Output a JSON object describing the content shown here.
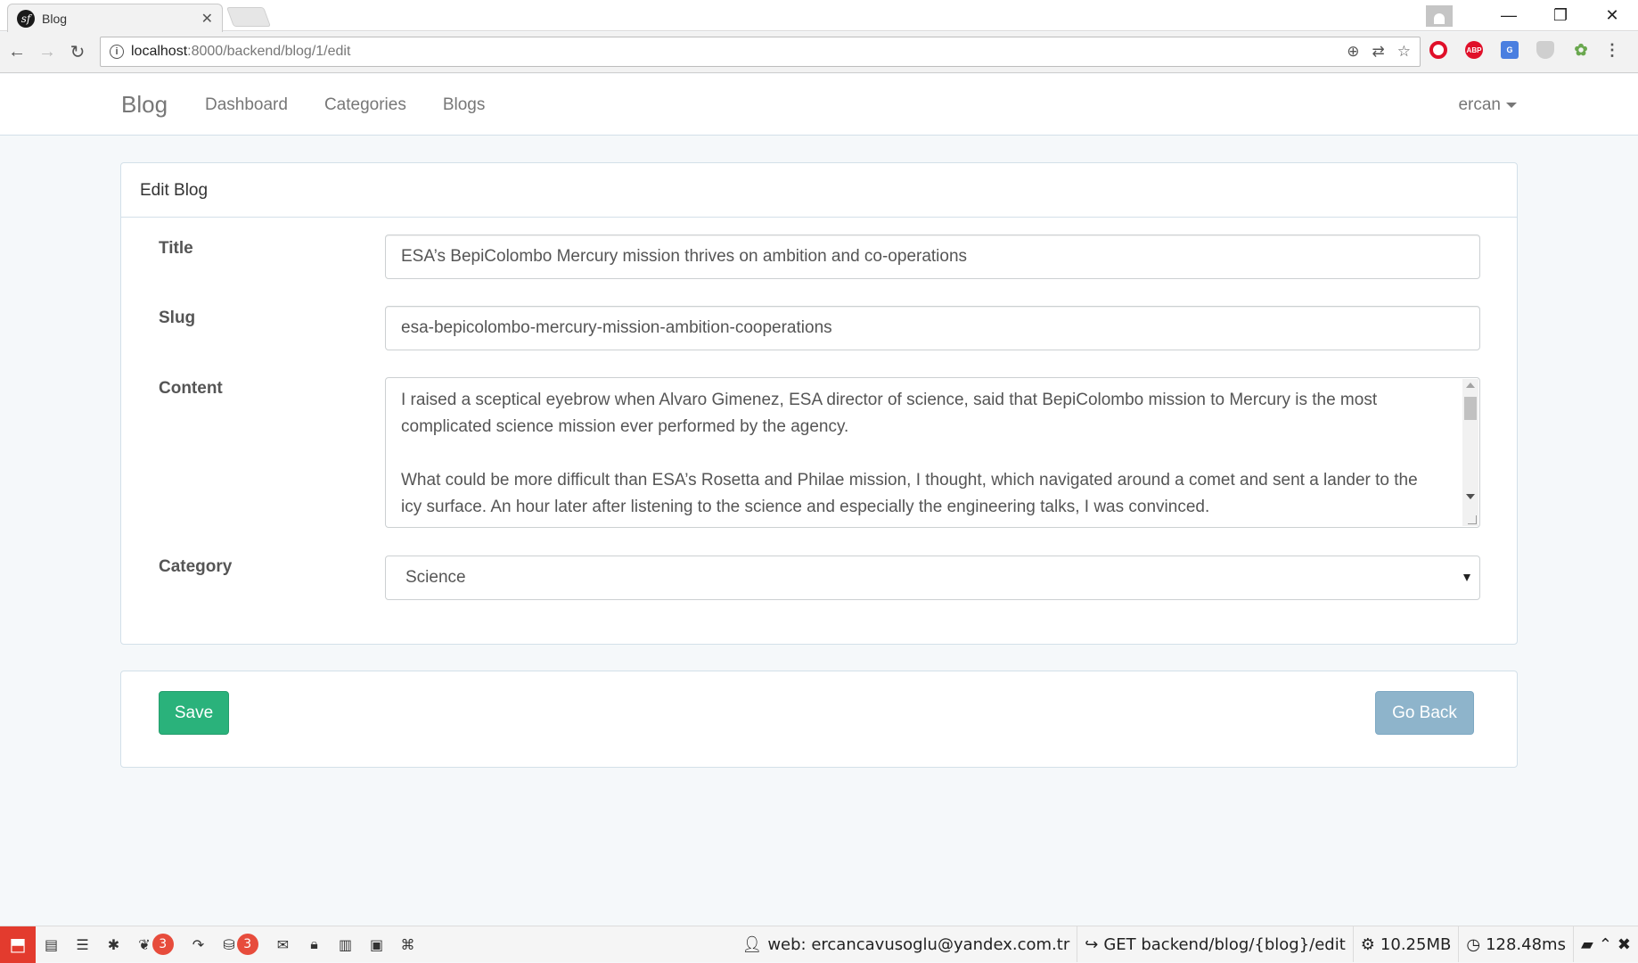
{
  "browser": {
    "tab_title": "Blog",
    "url_host": "localhost",
    "url_path": ":8000/backend/blog/1/edit",
    "extensions": [
      "opera-icon",
      "abp-icon",
      "google-translate-icon",
      "shield-icon",
      "leaf-icon",
      "menu-icon"
    ],
    "abp_label": "ABP"
  },
  "nav": {
    "brand": "Blog",
    "links": [
      "Dashboard",
      "Categories",
      "Blogs"
    ],
    "user": "ercan"
  },
  "form": {
    "heading": "Edit Blog",
    "title_label": "Title",
    "title_value": "ESA’s BepiColombo Mercury mission thrives on ambition and co-operations",
    "slug_label": "Slug",
    "slug_value": "esa-bepicolombo-mercury-mission-ambition-cooperations",
    "content_label": "Content",
    "content_p1": "I raised a sceptical eyebrow when Alvaro Gimenez, ESA director of science, said that BepiColombo mission to Mercury is the most complicated science mission ever performed by the agency.",
    "content_p2": "What could be more difficult than ESA’s Rosetta and Philae mission, I thought, which navigated around a comet and sent a lander to the icy surface. An hour later after listening to the science and especially the engineering talks, I was convinced.",
    "category_label": "Category",
    "category_value": "Science"
  },
  "actions": {
    "save": "Save",
    "back": "Go Back"
  },
  "sfbar": {
    "doctrine_count": "3",
    "db_count": "3",
    "user": "web: ercancavusoglu@yandex.com.tr",
    "route": "GET backend/blog/{blog}/edit",
    "memory": "10.25MB",
    "time": "128.48ms"
  }
}
